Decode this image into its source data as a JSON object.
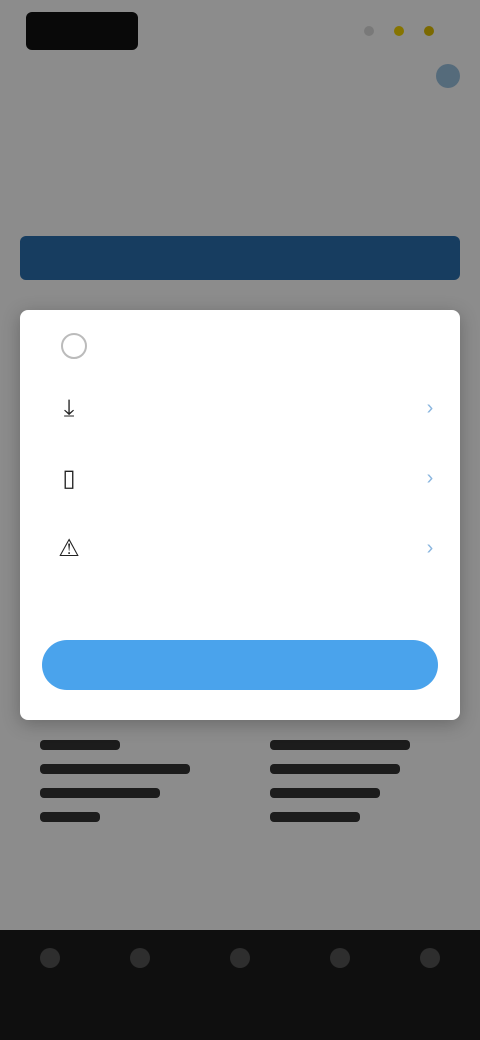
{
  "header": {
    "logo_text": "",
    "title": "",
    "subtitle": "",
    "primary_button_label": ""
  },
  "modal": {
    "title": "",
    "options": [
      {
        "icon": "download-icon",
        "label": "",
        "sublabel": ""
      },
      {
        "icon": "document-icon",
        "label": "",
        "sublabel": ""
      },
      {
        "icon": "warning-icon",
        "label": "",
        "sublabel": ""
      }
    ],
    "button_label": ""
  },
  "colors": {
    "primary_bar": "#2a6fb0",
    "modal_button": "#4aa3ec",
    "overlay": "rgba(0,0,0,0.45)",
    "nav_bar": "#1c1c1c"
  }
}
